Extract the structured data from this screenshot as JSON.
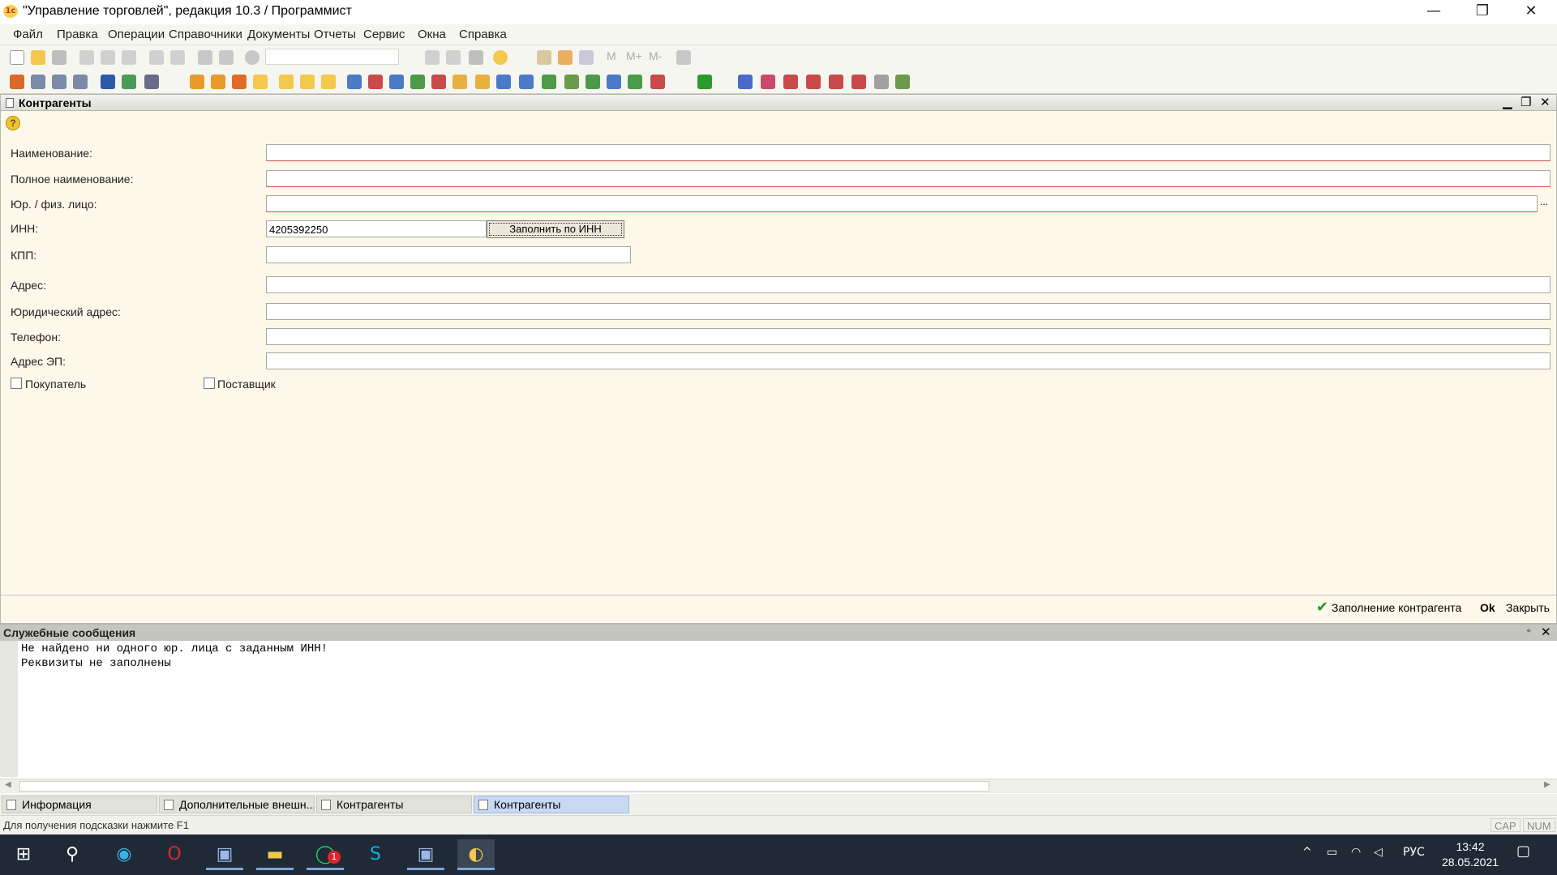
{
  "window": {
    "title": "\"Управление торговлей\", редакция 10.3 / Программист",
    "logo": "1с"
  },
  "menu": [
    {
      "label": "Файл"
    },
    {
      "label": "Правка"
    },
    {
      "label": "Операции"
    },
    {
      "label": "Справочники"
    },
    {
      "label": "Документы"
    },
    {
      "label": "Отчеты"
    },
    {
      "label": "Сервис"
    },
    {
      "label": "Окна"
    },
    {
      "label": "Справка"
    }
  ],
  "toolbar": {
    "icons": [
      "new-icon",
      "open-icon",
      "save-icon",
      "cut-icon",
      "copy-icon",
      "paste-icon",
      "print-icon",
      "preview-icon",
      "undo-icon",
      "redo-icon",
      "find-icon"
    ],
    "memory": [
      "M",
      "M+",
      "M-"
    ]
  },
  "form": {
    "title": "Контрагенты",
    "help": "?",
    "labels": {
      "name": "Наименование:",
      "full_name": "Полное наименование:",
      "legal_type": "Юр. / физ. лицо:",
      "inn": "ИНН:",
      "kpp": "КПП:",
      "address": "Адрес:",
      "legal_address": "Юридический адрес:",
      "phone": "Телефон:",
      "email": "Адрес ЭП:"
    },
    "values": {
      "name": "",
      "full_name": "",
      "legal_type": "",
      "inn": "4205392250",
      "kpp": "",
      "address": "",
      "legal_address": "",
      "phone": "",
      "email": ""
    },
    "fill_by_inn_button": "Заполнить по ИНН",
    "ellipsis": "...",
    "checkbox_buyer": "Покупатель",
    "checkbox_supplier": "Поставщик",
    "buyer_checked": false,
    "supplier_checked": false,
    "actions": {
      "fill_label": "Заполнение контрагента",
      "ok": "Ok",
      "close": "Закрыть"
    }
  },
  "messages": {
    "title": "Служебные сообщения",
    "lines": [
      "Не найдено ни одного юр. лица с заданным ИНН!",
      "Реквизиты не заполнены"
    ]
  },
  "window_tabs": [
    {
      "label": "Информация",
      "active": false
    },
    {
      "label": "Дополнительные внешн...",
      "active": false
    },
    {
      "label": "Контрагенты",
      "active": false
    },
    {
      "label": "Контрагенты",
      "active": true
    }
  ],
  "status": {
    "hint": "Для получения подсказки нажмите F1",
    "cap": "CAP",
    "num": "NUM"
  },
  "taskbar": {
    "apps": [
      "start-icon",
      "search-icon",
      "edge-icon",
      "opera-icon",
      "remote-desktop-icon",
      "explorer-icon",
      "whatsapp-icon",
      "skype-icon",
      "remote-desktop-2-icon",
      "1c-icon"
    ],
    "whatsapp_badge": "1",
    "language": "РУС",
    "time": "13:42",
    "date": "28.05.2021"
  }
}
